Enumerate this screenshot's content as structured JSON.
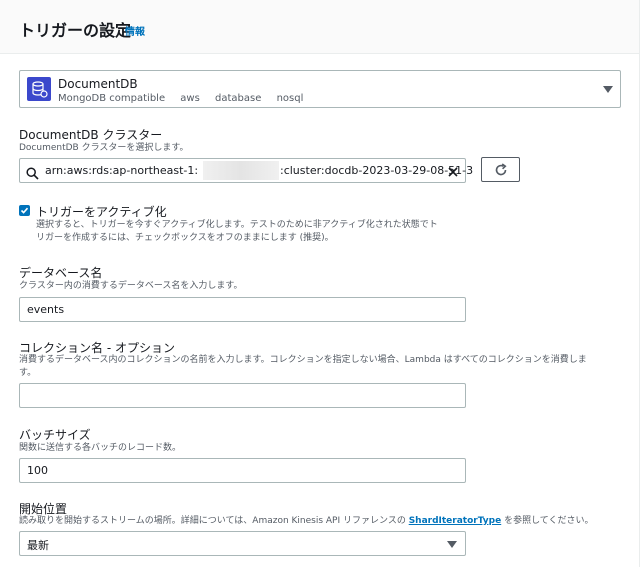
{
  "header": {
    "title": "トリガーの設定",
    "info_link": "情報"
  },
  "source": {
    "name": "DocumentDB",
    "tags": [
      "MongoDB compatible",
      "aws",
      "database",
      "nosql"
    ],
    "icon": "documentdb-icon"
  },
  "cluster": {
    "label": "DocumentDB クラスター",
    "description": "DocumentDB クラスターを選択します。",
    "value_prefix": "arn:aws:rds:ap-northeast-1:",
    "value_suffix": ":cluster:docdb-2023-03-29-08-51-3"
  },
  "activate": {
    "label": "トリガーをアクティブ化",
    "description_line1": "選択すると、トリガーを今すぐアクティブ化します。テストのために非アクティブ化された状態でト",
    "description_line2": "リガーを作成するには、チェックボックスをオフのままにします (推奨)。",
    "checked": true
  },
  "database": {
    "label": "データベース名",
    "description": "クラスター内の消費するデータベース名を入力します。",
    "value": "events"
  },
  "collection": {
    "label": "コレクション名 - オプション",
    "description_line1": "消費するデータベース内のコレクションの名前を入力します。コレクションを指定しない場合、Lambda はすべてのコレクションを消費しま",
    "description_line2": "す。",
    "value": ""
  },
  "batch": {
    "label": "バッチサイズ",
    "description": "関数に送信する各バッチのレコード数。",
    "value": "100"
  },
  "start_position": {
    "label": "開始位置",
    "description_prefix": "読み取りを開始するストリームの場所。詳細については、Amazon Kinesis API リファレンスの ",
    "description_link": "ShardIteratorType",
    "description_suffix": " を参照してください。",
    "value": "最新"
  },
  "colors": {
    "accent": "#0073bb",
    "border": "#aab7b8",
    "text": "#16191f",
    "muted": "#545b64"
  }
}
